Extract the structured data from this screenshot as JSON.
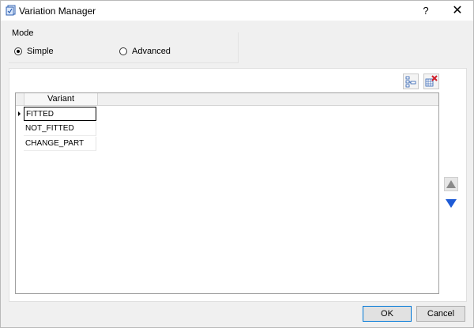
{
  "window": {
    "title": "Variation Manager",
    "help_label": "?",
    "close_label": "✕"
  },
  "mode": {
    "label": "Mode",
    "options": [
      {
        "label": "Simple",
        "selected": true
      },
      {
        "label": "Advanced",
        "selected": false
      }
    ]
  },
  "toolbar": {
    "icons": [
      "add-variant-icon",
      "delete-variant-icon"
    ]
  },
  "grid": {
    "column_header": "Variant",
    "rows": [
      "FITTED",
      "NOT_FITTED",
      "CHANGE_PART"
    ],
    "selected_row": 0
  },
  "side_buttons": {
    "icons": [
      "move-up-icon",
      "move-down-icon"
    ]
  },
  "footer": {
    "ok_label": "OK",
    "cancel_label": "Cancel"
  },
  "colors": {
    "accent": "#0078d7",
    "arrow_down": "#1e5bd6",
    "arrow_up": "#8a8a8a",
    "delete_x": "#d0202c"
  }
}
